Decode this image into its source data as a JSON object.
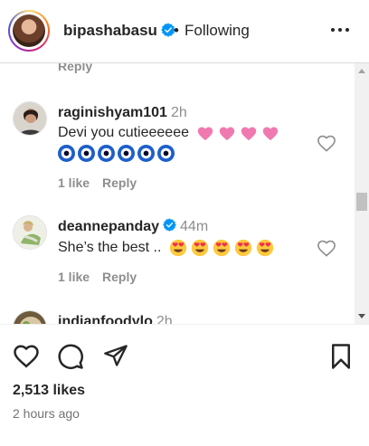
{
  "header": {
    "username": "bipashabasu",
    "separator": "•",
    "follow_status": "Following"
  },
  "comments": {
    "partial_reply_label": "Reply",
    "items": [
      {
        "username": "raginishyam101",
        "time": "2h",
        "text": "Devi you cutieeeeee",
        "likes": "1 like",
        "reply_label": "Reply"
      },
      {
        "username": "deannepanday",
        "time": "44m",
        "text": "She’s the best ..",
        "likes": "1 like",
        "reply_label": "Reply"
      },
      {
        "username": "indianfoodylo",
        "time": "2h"
      }
    ]
  },
  "post": {
    "likes": "2,513 likes",
    "time": "2 hours ago"
  },
  "colors": {
    "verified": "#0095f6",
    "muted_text": "#8e8e8e",
    "emoji_heart": "#f07ab0"
  }
}
